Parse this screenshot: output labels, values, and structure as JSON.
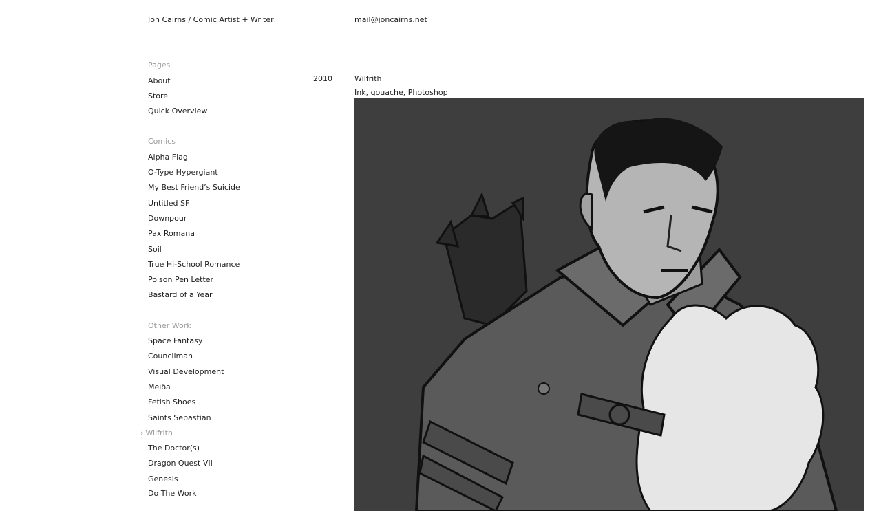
{
  "header": {
    "site_title": "Jon Cairns / Comic Artist + Writer",
    "email": "mail@joncairns.net"
  },
  "nav": {
    "pages_heading": "Pages",
    "pages": [
      "About",
      "Store",
      "Quick Overview"
    ],
    "comics_heading": "Comics",
    "comics": [
      "Alpha Flag",
      "O-Type Hypergiant",
      "My Best Friend’s Suicide",
      "Untitled SF",
      "Downpour",
      "Pax Romana",
      "Soil",
      "True Hi-School Romance",
      "Poison Pen Letter",
      "Bastard of a Year"
    ],
    "other_heading": "Other Work",
    "other": [
      "Space Fantasy",
      "Councilman",
      "Visual Development",
      "Meiða",
      "Fetish Shoes",
      "Saints Sebastian",
      "Wilfrith",
      "The Doctor(s)",
      "Dragon Quest VII",
      "Genesis",
      "Do The Work"
    ],
    "current": "Wilfrith"
  },
  "work": {
    "year": "2010",
    "title": "Wilfrith",
    "medium": "Ink, gouache, Photoshop",
    "image_icon": "artwork-illustration"
  }
}
